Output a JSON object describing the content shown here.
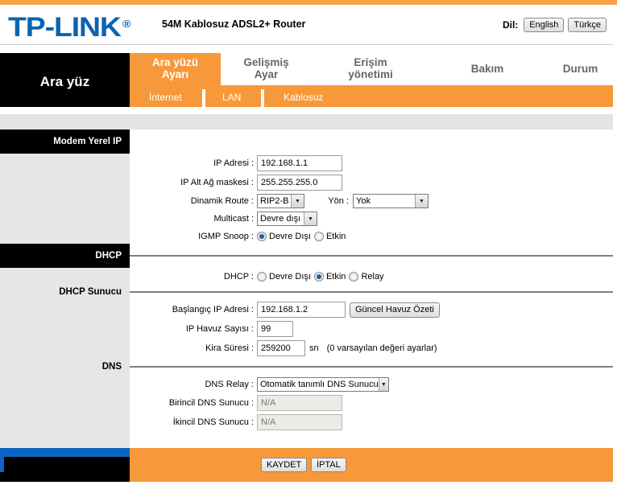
{
  "header": {
    "brand": "TP-LINK",
    "registered_mark": "®",
    "model": "54M Kablosuz ADSL2+ Router",
    "language_label": "Dil:",
    "language_buttons": [
      "English",
      "Türkçe"
    ]
  },
  "nav": {
    "section_title": "Ara yüz",
    "tabs": [
      {
        "line1": "Ara yüzü",
        "line2": "Ayarı",
        "active": true
      },
      {
        "line1": "Gelişmiş",
        "line2": "Ayar",
        "active": false
      },
      {
        "line1": "Erişim",
        "line2": "yönetimi",
        "active": false
      },
      {
        "line1": "Bakım",
        "line2": "",
        "active": false
      },
      {
        "line1": "Durum",
        "line2": "",
        "active": false
      }
    ],
    "subtabs": [
      "İnternet",
      "LAN",
      "Kablosuz"
    ]
  },
  "sections": {
    "modem_local_ip": "Modem Yerel IP",
    "dhcp": "DHCP",
    "dhcp_server": "DHCP Sunucu",
    "dns": "DNS"
  },
  "form": {
    "ip_address": {
      "label": "IP Adresi :",
      "value": "192.168.1.1"
    },
    "subnet_mask": {
      "label": "IP Alt Ağ maskesi :",
      "value": "255.255.255.0"
    },
    "dynamic_route": {
      "label": "Dinamik Route :",
      "value": "RIP2-B"
    },
    "direction": {
      "label": "Yön :",
      "value": "Yok"
    },
    "multicast": {
      "label": "Multicast :",
      "value": "Devre dışı"
    },
    "igmp_snoop": {
      "label": "IGMP Snoop :",
      "options": [
        "Devre Dışı",
        "Etkin"
      ],
      "selected": "Devre Dışı"
    },
    "dhcp": {
      "label": "DHCP :",
      "options": [
        "Devre Dışı",
        "Etkin",
        "Relay"
      ],
      "selected": "Etkin"
    },
    "start_ip": {
      "label": "Başlangıç IP Adresi :",
      "value": "192.168.1.2",
      "button": "Güncel Havuz Özeti"
    },
    "pool_count": {
      "label": "IP Havuz Sayısı :",
      "value": "99"
    },
    "lease_time": {
      "label": "Kira Süresi :",
      "value": "259200",
      "unit": "sn",
      "note": "(0 varsayılan değeri ayarlar)"
    },
    "dns_relay": {
      "label": "DNS Relay :",
      "value": "Otomatik tanımlı DNS Sunucu"
    },
    "primary_dns": {
      "label": "Birincil DNS Sunucu :",
      "value": "N/A"
    },
    "secondary_dns": {
      "label": "İkincil DNS Sunucu :",
      "value": "N/A"
    }
  },
  "footer": {
    "save": "KAYDET",
    "cancel": "İPTAL"
  },
  "colors": {
    "brand_blue": "#0b64ae",
    "accent_orange": "#f7993a",
    "sidebar_gray": "#e6e6e6"
  }
}
